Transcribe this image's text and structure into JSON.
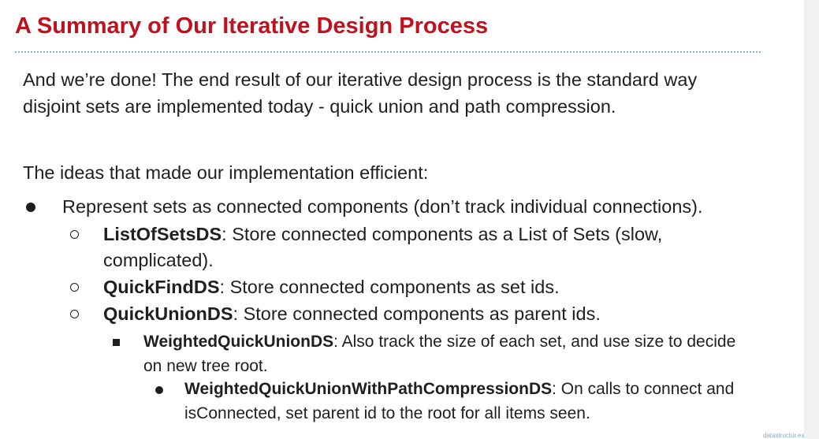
{
  "slide": {
    "title": "A Summary of Our Iterative Design Process",
    "para1_line1": "And we’re done! The end result of our iterative design process is the standard way",
    "para1_line2": "disjoint sets are implemented today - quick union and path compression.",
    "para2": "The ideas that made our implementation efficient:",
    "bullets": [
      {
        "text": "Represent sets as connected components (don’t track individual connections)."
      },
      {
        "name": "ListOfSetsDS",
        "text_line1": ": Store connected components as a List of Sets (slow,",
        "text_line2": "complicated)."
      },
      {
        "name": "QuickFindDS",
        "text": ": Store connected components as set ids."
      },
      {
        "name": "QuickUnionDS",
        "text": ": Store connected components as parent ids."
      },
      {
        "name": "WeightedQuickUnionDS",
        "text_line1": ": Also track the size of each set, and use size to decide",
        "text_line2": "on new tree root."
      },
      {
        "name": "WeightedQuickUnionWithPathCompressionDS",
        "text_line1": ": On calls to connect and",
        "text_line2": "isConnected, set parent id to the root for all items seen."
      }
    ],
    "footer": "datastructur.es"
  },
  "colors": {
    "title": "#c0121e",
    "rule": "#86b5d6",
    "text": "#1f1f1f"
  }
}
